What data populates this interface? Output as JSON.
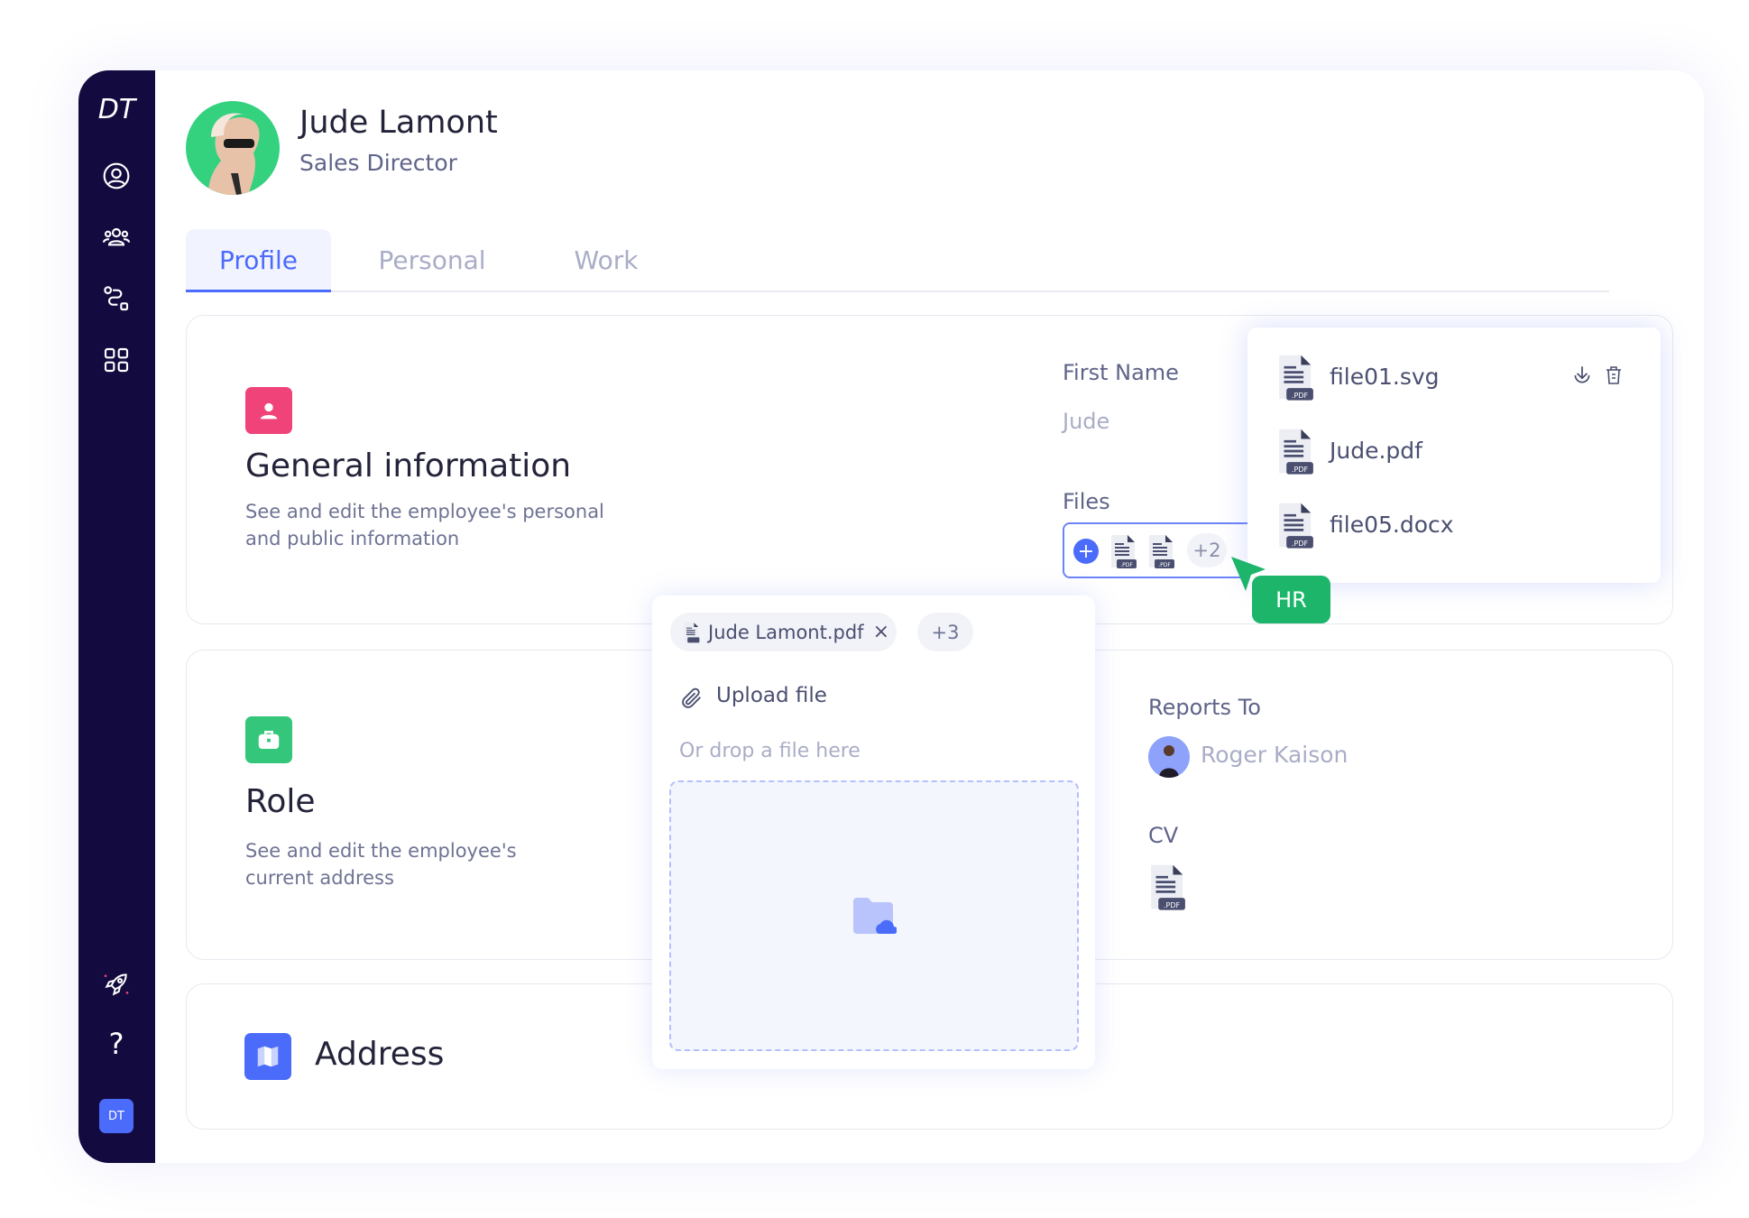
{
  "sidebar": {
    "logo": "DT",
    "icons": [
      "user-circle-icon",
      "users-icon",
      "route-icon",
      "grid-icon",
      "rocket-icon",
      "help-icon"
    ],
    "user_badge": "DT"
  },
  "header": {
    "name": "Jude Lamont",
    "title": "Sales Director"
  },
  "tabs": [
    {
      "label": "Profile",
      "active": true
    },
    {
      "label": "Personal"
    },
    {
      "label": "Work"
    }
  ],
  "general": {
    "title": "General information",
    "description_1": "See and edit the employee's personal",
    "description_2": "and public information",
    "first_name_label": "First Name",
    "first_name_value": "Jude",
    "files_label": "Files",
    "files_more": "+2"
  },
  "files_dropdown": {
    "items": [
      {
        "name": "file01.svg",
        "badge": ".PDF"
      },
      {
        "name": "Jude.pdf",
        "badge": ".PDF"
      },
      {
        "name": "file05.docx",
        "badge": ".PDF"
      }
    ]
  },
  "cursor_tag": "HR",
  "role": {
    "title": "Role",
    "description_1": "See and edit the employee's",
    "description_2": "current address",
    "reports_to_label": "Reports To",
    "reports_to_value": "Roger Kaison",
    "cv_label": "CV",
    "cv_badge": ".PDF"
  },
  "address": {
    "title": "Address"
  },
  "upload": {
    "chip_file": "Jude Lamont.pdf",
    "chip_more": "+3",
    "upload_label": "Upload file",
    "drop_hint": "Or drop a file here"
  },
  "colors": {
    "sidebar": "#130b3f",
    "accent": "#4b6bfb",
    "green": "#1db56a",
    "pink": "#f0437a"
  }
}
